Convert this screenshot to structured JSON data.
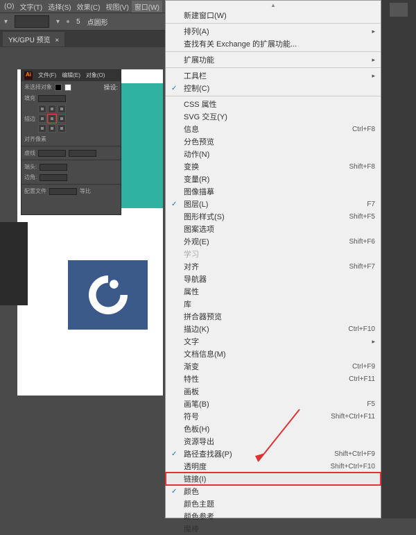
{
  "menubar": [
    "(O)",
    "文字(T)",
    "选择(S)",
    "效果(C)",
    "视图(V)",
    "窗口(W)"
  ],
  "toolbar": {
    "stroke_value": "5",
    "stroke_unit": "点圆形"
  },
  "tab": {
    "label": "YK/GPU 预览"
  },
  "panel_a": {
    "tabs": [
      "文件(F)",
      "编辑(E)",
      "对象(O)"
    ],
    "row1_left": "未选择对象",
    "row1_right": "操设:",
    "lbl_fill": "填充",
    "lbl_stroke": "描边",
    "lbl_align": "对齐像素",
    "cb_dashed": "虚线",
    "lbl_corner": "端头:",
    "lbl_join": "边角:",
    "footer_left": "配置文件",
    "footer_right": "等比"
  },
  "menu": {
    "new_window": "新建窗口(W)",
    "arrange": "排列(A)",
    "find_ext": "查找有关 Exchange 的扩展功能...",
    "extensions": "扩展功能",
    "workspace": "工具栏",
    "control": "控制(C)",
    "css_prop": "CSS 属性",
    "svg_inter": "SVG 交互(Y)",
    "info": "信息",
    "info_sc": "Ctrl+F8",
    "sep_preview": "分色预览",
    "actions": "动作(N)",
    "transform": "变换",
    "transform_sc": "Shift+F8",
    "variables": "变量(R)",
    "image_trace": "图像描摹",
    "layers": "图层(L)",
    "layers_sc": "F7",
    "graphic_styles": "图形样式(S)",
    "graphic_styles_sc": "Shift+F5",
    "pattern_opts": "图案选项",
    "appearance": "外观(E)",
    "appearance_sc": "Shift+F6",
    "learn": "学习",
    "align": "对齐",
    "align_sc": "Shift+F7",
    "navigator": "导航器",
    "attributes": "属性",
    "libraries": "库",
    "flattener": "拼合器预览",
    "stroke": "描边(K)",
    "stroke_sc": "Ctrl+F10",
    "type": "文字",
    "doc_info": "文档信息(M)",
    "gradient": "渐变",
    "gradient_sc": "Ctrl+F9",
    "live_paint": "特性",
    "live_paint_sc": "Ctrl+F11",
    "artboards": "画板",
    "brushes": "画笔(B)",
    "brushes_sc": "F5",
    "symbols": "符号",
    "symbols_sc": "Shift+Ctrl+F11",
    "swatches": "色板(H)",
    "asset_export": "资源导出",
    "pathfinder": "路径查找器(P)",
    "pathfinder_sc": "Shift+Ctrl+F9",
    "transparency": "透明度",
    "transparency_sc": "Shift+Ctrl+F10",
    "links": "链接(I)",
    "color": "颜色",
    "color_themes": "颜色主题",
    "color_guide": "颜色参考",
    "magic_wand": "魔棒"
  }
}
